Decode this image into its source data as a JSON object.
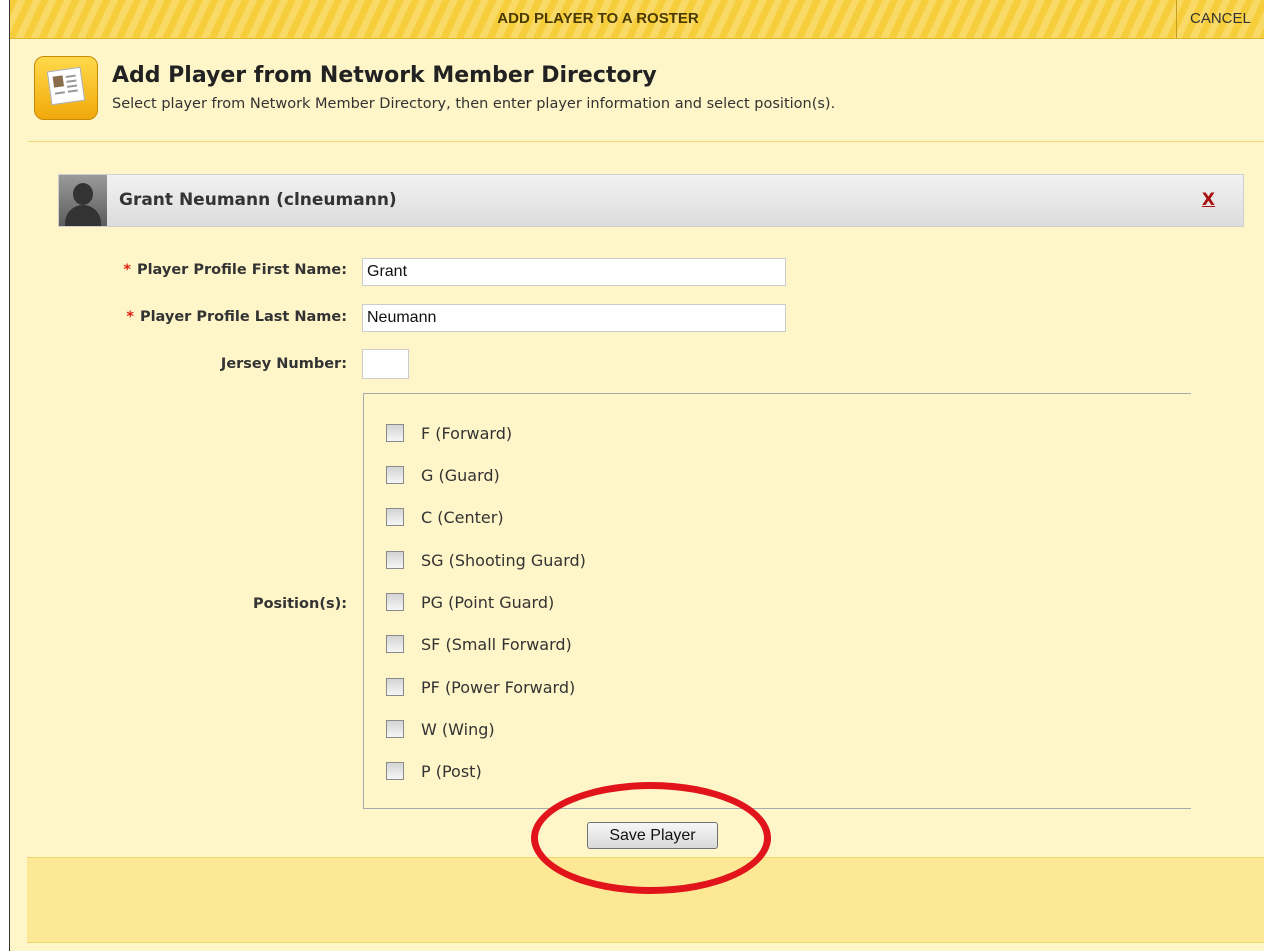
{
  "topbar": {
    "title": "ADD PLAYER TO A ROSTER",
    "cancel_label": "CANCEL"
  },
  "header": {
    "icon": "directory-card-icon",
    "title": "Add Player from Network Member Directory",
    "subtitle": "Select player from Network Member Directory, then enter player information and select position(s)."
  },
  "member": {
    "avatar_icon": "person-silhouette-icon",
    "name": "Grant Neumann (clneumann)",
    "remove_label": "X"
  },
  "form": {
    "required_marker": "*",
    "first_name": {
      "label": "Player Profile First Name:",
      "value": "Grant"
    },
    "last_name": {
      "label": "Player Profile Last Name:",
      "value": "Neumann"
    },
    "jersey": {
      "label": "Jersey Number:",
      "value": ""
    },
    "positions_label": "Position(s):",
    "positions": [
      {
        "label": "F (Forward)",
        "checked": false
      },
      {
        "label": "G (Guard)",
        "checked": false
      },
      {
        "label": "C (Center)",
        "checked": false
      },
      {
        "label": "SG (Shooting Guard)",
        "checked": false
      },
      {
        "label": "PG (Point Guard)",
        "checked": false
      },
      {
        "label": "SF (Small Forward)",
        "checked": false
      },
      {
        "label": "PF (Power Forward)",
        "checked": false
      },
      {
        "label": "W (Wing)",
        "checked": false
      },
      {
        "label": "P (Post)",
        "checked": false
      }
    ]
  },
  "footer": {
    "save_label": "Save Player"
  },
  "colors": {
    "background": "#fef5c8",
    "topbar": "#f6cd3a",
    "footer": "#fde896",
    "highlight_ring": "#e0141a",
    "required": "#d21111"
  }
}
